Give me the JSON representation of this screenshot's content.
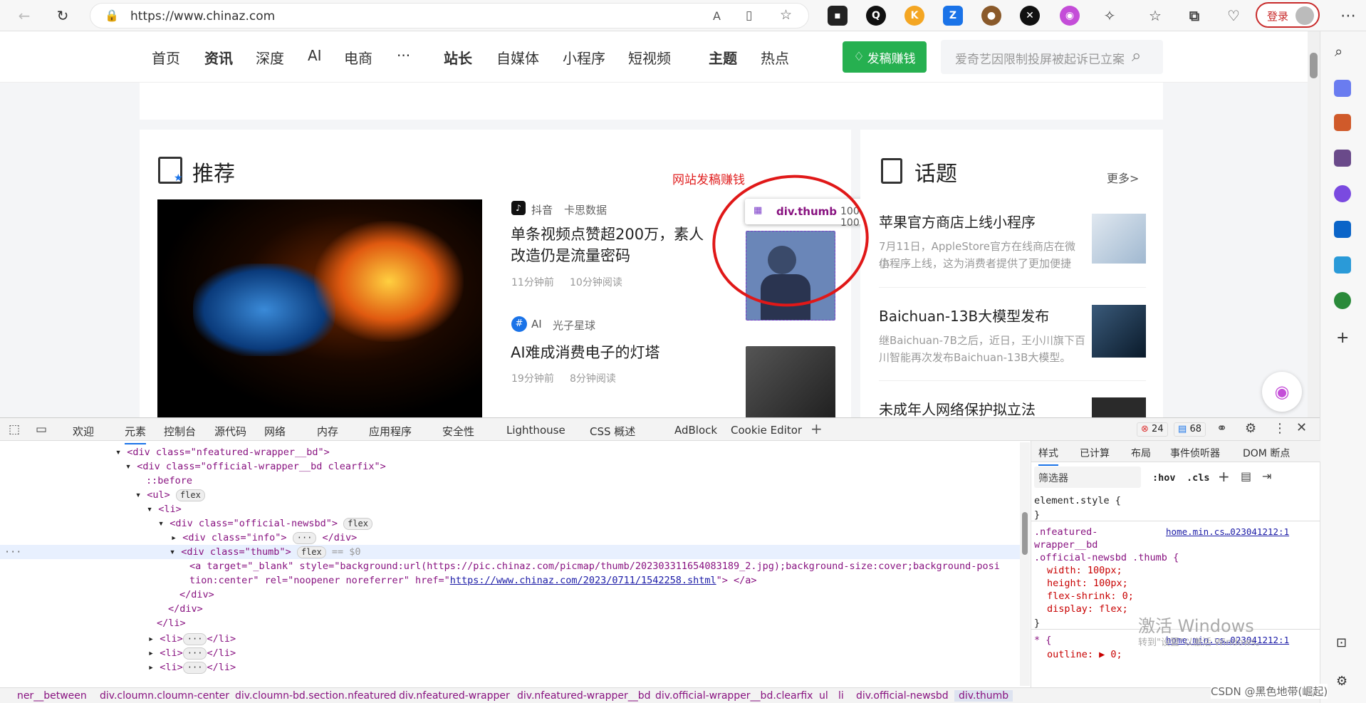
{
  "browser": {
    "url": "https://www.chinaz.com",
    "login_label": "登录"
  },
  "site": {
    "nav": [
      "首页",
      "资讯",
      "深度",
      "AI",
      "电商",
      "···",
      "站长",
      "自媒体",
      "小程序",
      "短视频",
      "主题",
      "热点"
    ],
    "post_button": "发稿赚钱",
    "search_placeholder": "爱奇艺因限制投屏被起诉已立案"
  },
  "recommend": {
    "heading": "推荐",
    "promo_link": "网站发稿赚钱",
    "articles": [
      {
        "source": "抖音",
        "tag": "卡思数据",
        "title_line1": "单条视频点赞超200万，素人",
        "title_line2": "改造仍是流量密码",
        "time": "11分钟前",
        "read": "10分钟阅读"
      },
      {
        "source": "AI",
        "tag": "光子星球",
        "title_line1": "AI难成消费电子的灯塔",
        "title_line2": "",
        "time": "19分钟前",
        "read": "8分钟阅读"
      }
    ]
  },
  "topics": {
    "heading": "话题",
    "more": "更多>",
    "items": [
      {
        "title": "苹果官方商店上线小程序",
        "desc_line1": "7月11日，AppleStore官方在线商店在微信",
        "desc_line2": "小程序上线，这为消费者提供了更加便捷"
      },
      {
        "title": "Baichuan-13B大模型发布",
        "desc_line1": "继Baichuan-7B之后，近日，王小川旗下百",
        "desc_line2": "川智能再次发布Baichuan-13B大模型。"
      },
      {
        "title": "未成年人网络保护拟立法",
        "desc_line1": "",
        "desc_line2": ""
      }
    ]
  },
  "inspector_tooltip": {
    "selector": "div.thumb",
    "size": "100 × 100"
  },
  "devtools": {
    "tabs": [
      "欢迎",
      "元素",
      "控制台",
      "源代码",
      "网络",
      "内存",
      "应用程序",
      "安全性",
      "Lighthouse",
      "CSS 概述",
      "AdBlock",
      "Cookie Editor"
    ],
    "active_tab": "元素",
    "errors": "24",
    "messages": "68",
    "dom_lines": [
      "<div class=\"nfeatured-wrapper__bd\">",
      "<div class=\"official-wrapper__bd clearfix\">",
      "::before",
      "<ul>",
      "<li>",
      "<div class=\"official-newsbd\">",
      "<div class=\"info\">",
      "</div>",
      "<div class=\"thumb\">",
      "== $0",
      "<a target=\"_blank\" style=\"background:url(https://pic.chinaz.com/picmap/thumb/202303311654083189_2.jpg);background-size:cover;background-posi",
      "tion:center\" rel=\"noopener noreferrer\" href=\"",
      "https://www.chinaz.com/2023/0711/1542258.shtml",
      "\"> </a>",
      "</div>",
      "</div>",
      "</li>",
      "<li>",
      "</li>"
    ],
    "flex_pill": "flex",
    "ellipsis_pill": "···",
    "styles_tabs": [
      "样式",
      "已计算",
      "布局",
      "事件侦听器",
      "DOM 断点"
    ],
    "filter_placeholder": "筛选器",
    "hov": ":hov",
    "cls": ".cls",
    "element_style": "element.style {",
    "close_brace": "}",
    "rule_selector_1": ".nfeatured-",
    "rule_selector_2": "wrapper__bd",
    "rule_selector_3": ".official-newsbd .thumb {",
    "rule_source": "home.min.cs…023041212:1",
    "props": [
      "width: 100px;",
      "height: 100px;",
      "flex-shrink: 0;",
      "display: flex;"
    ],
    "universal_rule": "* {",
    "outline_prop": "outline: ▶ 0;",
    "breadcrumbs": [
      "ner__between",
      "div.cloumn.cloumn-center",
      "div.cloumn-bd.section.nfeatured",
      "div.nfeatured-wrapper",
      "div.nfeatured-wrapper__bd",
      "div.official-wrapper__bd.clearfix",
      "ul",
      "li",
      "div.official-newsbd",
      "div.thumb"
    ],
    "watermark_line1": "激活 Windows",
    "watermark_line2": "转到\"设置\"以激活 Windows。",
    "csdn": "CSDN @黑色地带(崛起)"
  }
}
